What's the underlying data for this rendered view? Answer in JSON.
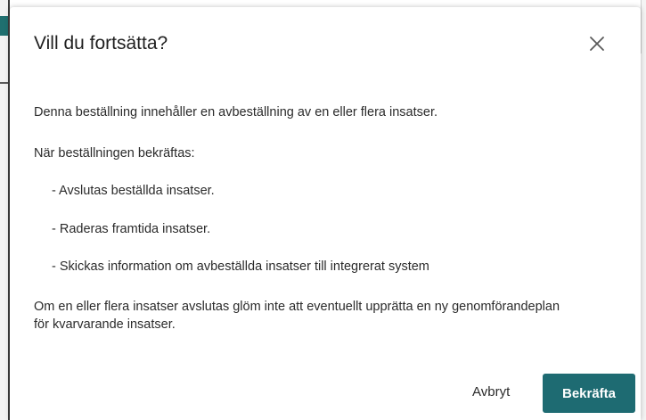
{
  "dialog": {
    "title": "Vill du fortsätta?",
    "close_icon": "close-icon",
    "intro": "Denna beställning innehåller en avbeställning av en eller flera insatser.",
    "confirm_heading": "När beställningen bekräftas:",
    "items": [
      "- Avslutas beställda insatser.",
      "- Raderas framtida insatser.",
      "- Skickas information om avbeställda insatser till integrerat system"
    ],
    "note": "Om en eller flera insatser avslutas glöm inte att eventuellt upprätta en ny genomförandeplan för kvarvarande insatser.",
    "cancel_label": "Avbryt",
    "confirm_label": "Bekräfta"
  },
  "colors": {
    "primary": "#1e6b72",
    "text": "#2b2b2b"
  }
}
